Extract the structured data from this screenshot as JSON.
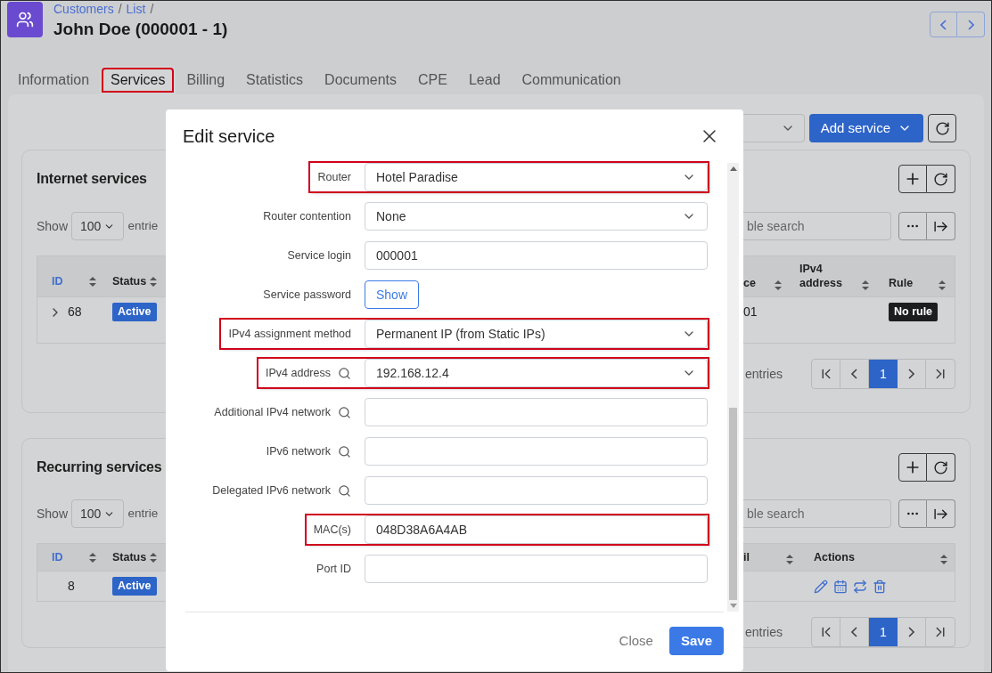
{
  "breadcrumbs": [
    {
      "label": "Customers",
      "separator": "/"
    },
    {
      "label": "List",
      "separator": "/"
    }
  ],
  "title": "John Doe (000001 - 1)",
  "tabs": [
    {
      "label": "Information",
      "selected": false,
      "highlighted": false
    },
    {
      "label": "Services",
      "selected": true,
      "highlighted": true
    },
    {
      "label": "Billing",
      "selected": false,
      "highlighted": false
    },
    {
      "label": "Statistics",
      "selected": false,
      "highlighted": false
    },
    {
      "label": "Documents",
      "selected": false,
      "highlighted": false
    },
    {
      "label": "CPE",
      "selected": false,
      "highlighted": false
    },
    {
      "label": "Lead",
      "selected": false,
      "highlighted": false
    },
    {
      "label": "Communication",
      "selected": false,
      "highlighted": false
    }
  ],
  "toolbar": {
    "add_button": "Add service"
  },
  "sections": [
    {
      "title": "Internet services",
      "show_label": "Show",
      "page_size": "100",
      "entries_label": "entrie",
      "search_placeholder": "ble search",
      "footer_entries": "entries",
      "page": "1",
      "columns_left": [
        "ID",
        "Status"
      ],
      "columns_right": [
        "ce",
        "IPv4 address",
        "Rule"
      ],
      "rows": [
        {
          "expandable": true,
          "left": [
            {
              "kind": "text",
              "text": "68"
            },
            {
              "kind": "badge",
              "text": "Active"
            }
          ],
          "right": [
            {
              "kind": "text",
              "text": "01"
            },
            {
              "kind": "empty"
            },
            {
              "kind": "dark_badge",
              "text": "No rule"
            }
          ]
        }
      ]
    },
    {
      "title": "Recurring services",
      "show_label": "Show",
      "page_size": "100",
      "entries_label": "entrie",
      "search_placeholder": "ble search",
      "footer_entries": "entries",
      "page": "1",
      "columns_left": [
        "ID",
        "Status"
      ],
      "columns_right": [
        "il",
        "Actions"
      ],
      "rows": [
        {
          "expandable": false,
          "left": [
            {
              "kind": "text",
              "text": "8"
            },
            {
              "kind": "badge",
              "text": "Active"
            }
          ],
          "right": [
            {
              "kind": "empty"
            },
            {
              "kind": "actions"
            }
          ]
        }
      ]
    }
  ],
  "modal": {
    "title": "Edit service",
    "close": "Close",
    "save": "Save",
    "fields": [
      {
        "label": "Router",
        "search": false,
        "kind": "select",
        "value": "Hotel Paradise",
        "highlighted": true
      },
      {
        "label": "Router contention",
        "search": false,
        "kind": "select",
        "value": "None",
        "highlighted": false
      },
      {
        "label": "Service login",
        "search": false,
        "kind": "input",
        "value": "000001",
        "highlighted": false
      },
      {
        "label": "Service password",
        "search": false,
        "kind": "button",
        "value": "Show",
        "highlighted": false
      },
      {
        "label": "IPv4 assignment method",
        "search": false,
        "kind": "select",
        "value": "Permanent IP (from Static IPs)",
        "highlighted": true
      },
      {
        "label": "IPv4 address",
        "search": true,
        "kind": "select",
        "value": "192.168.12.4",
        "highlighted": true
      },
      {
        "label": "Additional IPv4 network",
        "search": true,
        "kind": "input",
        "highlighted": false
      },
      {
        "label": "IPv6 network",
        "search": true,
        "kind": "input",
        "highlighted": false
      },
      {
        "label": "Delegated IPv6 network",
        "search": true,
        "kind": "input",
        "highlighted": false
      },
      {
        "label": "MAC(s)",
        "search": false,
        "kind": "input",
        "value": "048D38A6A4AB",
        "highlighted": true
      },
      {
        "label": "Port ID",
        "search": false,
        "kind": "input",
        "highlighted": false
      }
    ]
  }
}
